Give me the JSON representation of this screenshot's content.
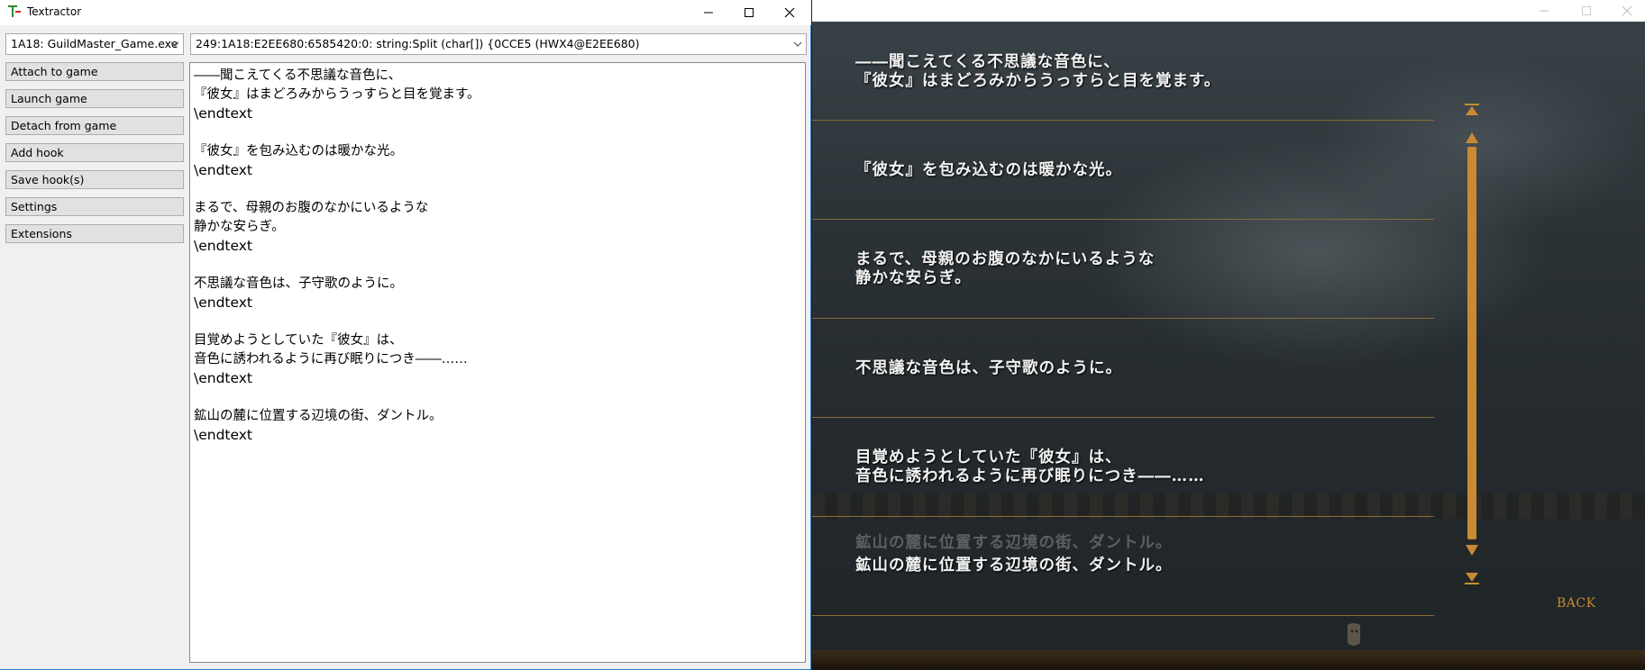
{
  "textractor": {
    "title": "Textractor",
    "process": "1A18: GuildMaster_Game.exe",
    "hook": "249:1A18:E2EE680:6585420:0:  string:Split (char[]) {0CCE5 (HWX4@E2EE680)",
    "buttons": {
      "attach": "Attach to game",
      "launch": "Launch game",
      "detach": "Detach from game",
      "add_hook": "Add hook",
      "save_hooks": "Save hook(s)",
      "settings": "Settings",
      "extensions": "Extensions"
    },
    "end_marker": "\\endtext",
    "entries": [
      "――聞こえてくる不思議な音色に、\n『彼女』はまどろみからうっすらと目を覚ます。",
      "『彼女』を包み込むのは暖かな光。",
      "まるで、母親のお腹のなかにいるような\n静かな安らぎ。",
      "不思議な音色は、子守歌のように。",
      "目覚めようとしていた『彼女』は、\n音色に誘われるように再び眠りにつき――……",
      "鉱山の麓に位置する辺境の街、ダントル。"
    ]
  },
  "game": {
    "log": [
      "――聞こえてくる不思議な音色に、\n『彼女』はまどろみからうっすらと目を覚ます。",
      "『彼女』を包み込むのは暖かな光。",
      "まるで、母親のお腹のなかにいるような\n静かな安らぎ。",
      "不思議な音色は、子守歌のように。",
      "目覚めようとしていた『彼女』は、\n音色に誘われるように再び眠りにつき――……",
      "鉱山の麓に位置する辺境の街、ダントル。"
    ],
    "ghost": "鉱山の麓に位置する辺境の街、ダントル。",
    "back_label": "BACK"
  },
  "colors": {
    "accent_orange": "#c98a33",
    "separator": "#8a6a35",
    "window_border": "#2b7bd0"
  }
}
